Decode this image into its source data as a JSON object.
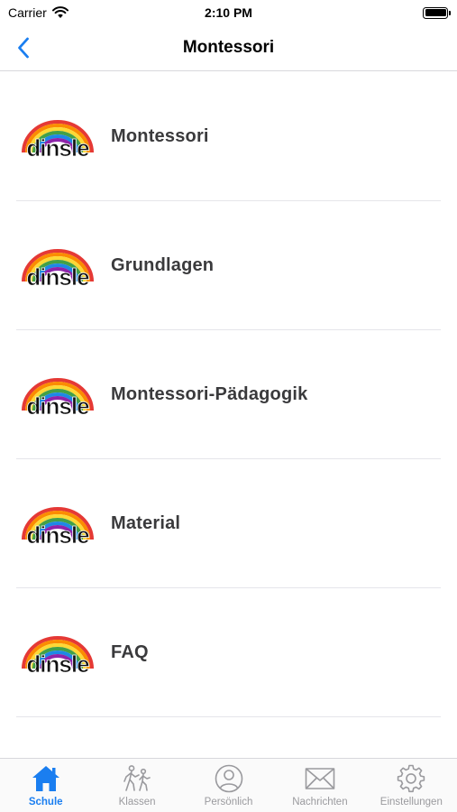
{
  "status_bar": {
    "carrier": "Carrier",
    "time": "2:10 PM"
  },
  "nav": {
    "title": "Montessori"
  },
  "list": {
    "items": [
      {
        "label": "Montessori"
      },
      {
        "label": "Grundlagen"
      },
      {
        "label": "Montessori-Pädagogik"
      },
      {
        "label": "Material"
      },
      {
        "label": "FAQ"
      }
    ]
  },
  "tabs": [
    {
      "label": "Schule",
      "icon": "house-icon",
      "active": true
    },
    {
      "label": "Klassen",
      "icon": "people-walking-icon",
      "active": false
    },
    {
      "label": "Persönlich",
      "icon": "person-circle-icon",
      "active": false
    },
    {
      "label": "Nachrichten",
      "icon": "envelope-icon",
      "active": false
    },
    {
      "label": "Einstellungen",
      "icon": "gear-icon",
      "active": false
    }
  ],
  "colors": {
    "accent": "#1a7ef0",
    "inactive": "#9a9a9e"
  }
}
